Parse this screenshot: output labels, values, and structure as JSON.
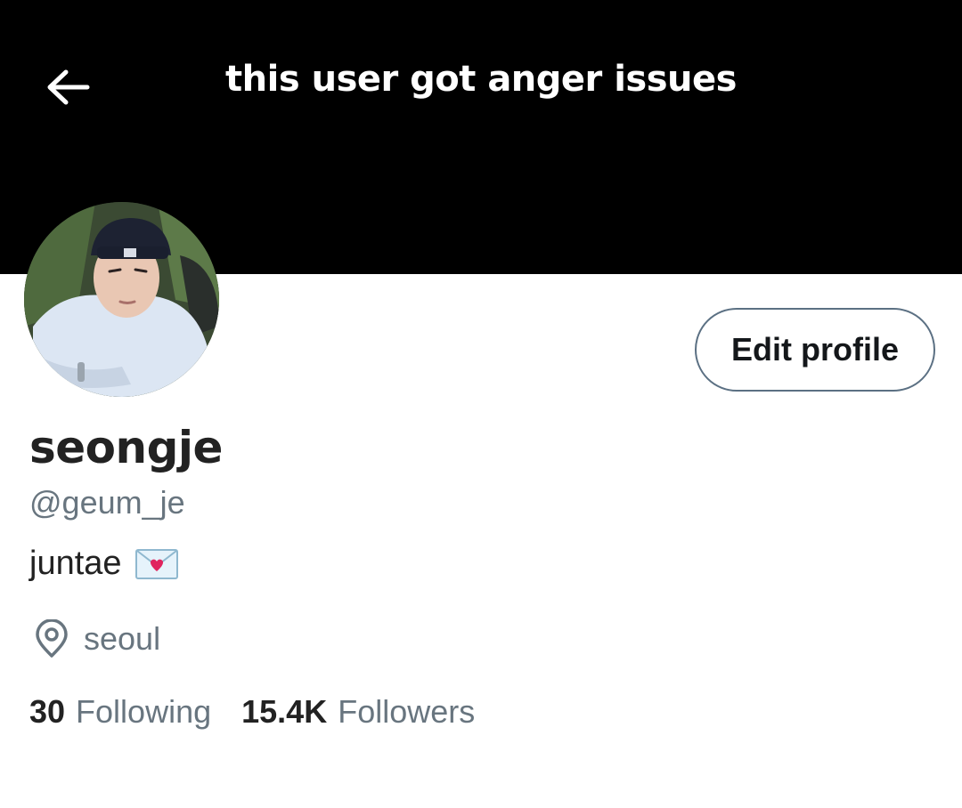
{
  "header": {
    "banner_text": "this user got anger issues",
    "back_icon": "arrow-left-icon",
    "banner_color": "#000000"
  },
  "profile": {
    "display_name": "seongje",
    "handle": "@geum_je",
    "bio": "juntae",
    "bio_emoji": "love-letter-icon",
    "location_icon": "location-pin-icon",
    "location": "seoul",
    "edit_button_label": "Edit profile"
  },
  "stats": {
    "following_count": "30",
    "following_label": "Following",
    "followers_count": "15.4K",
    "followers_label": "Followers"
  },
  "colors": {
    "text_primary": "#222222",
    "text_secondary": "#68757f",
    "button_border": "#5b7083"
  }
}
